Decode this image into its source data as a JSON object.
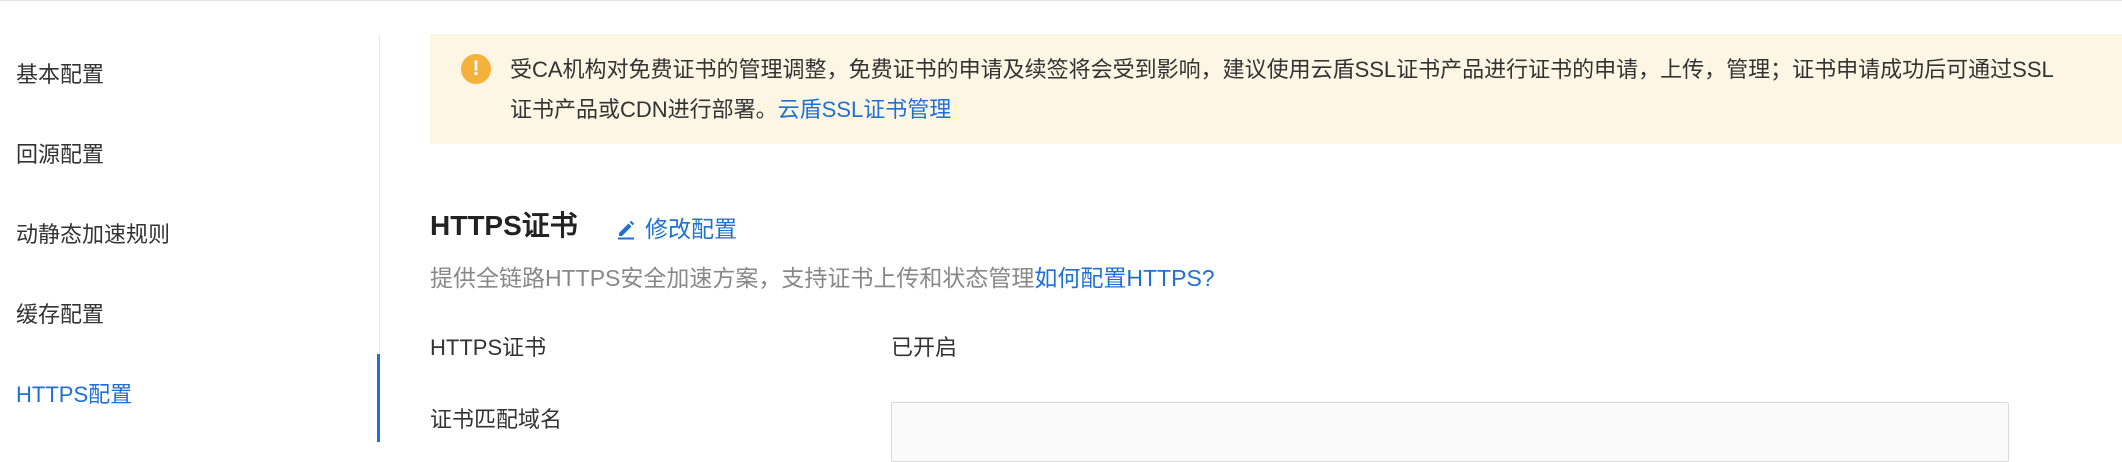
{
  "sidebar": {
    "items": [
      {
        "label": "基本配置"
      },
      {
        "label": "回源配置"
      },
      {
        "label": "动静态加速规则"
      },
      {
        "label": "缓存配置"
      },
      {
        "label": "HTTPS配置",
        "active": true
      }
    ]
  },
  "notice": {
    "icon": "warning-icon",
    "icon_glyph": "!",
    "text": "受CA机构对免费证书的管理调整，免费证书的申请及续签将会受到影响，建议使用云盾SSL证书产品进行证书的申请，上传，管理；证书申请成功后可通过SSL证书产品或CDN进行部署。",
    "link_text": "云盾SSL证书管理"
  },
  "section": {
    "title": "HTTPS证书",
    "edit_label": "修改配置",
    "edit_icon": "pencil-icon",
    "description": "提供全链路HTTPS安全加速方案，支持证书上传和状态管理",
    "help_link": "如何配置HTTPS?"
  },
  "fields": [
    {
      "label": "HTTPS证书",
      "value": "已开启"
    },
    {
      "label": "证书匹配域名",
      "value": ""
    }
  ],
  "colors": {
    "accent": "#1f6fd6",
    "notice_bg": "#fdf6e4",
    "warning": "#f3b23c"
  }
}
